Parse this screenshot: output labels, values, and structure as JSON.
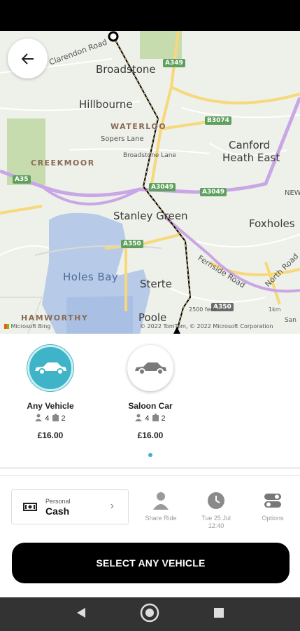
{
  "map": {
    "places": {
      "clarendon": "Clarendon Road",
      "broadstone": "Broadstone",
      "hillbourne": "Hillbourne",
      "waterloo": "WATERLOO",
      "sopers": "Sopers Lane",
      "broadstone_lane": "Broadstone Lane",
      "canford": "Canford",
      "canford2": "Heath East",
      "creekmoor": "CREEKMOOR",
      "stanley": "Stanley Green",
      "foxholes": "Foxholes",
      "holes_bay": "Holes Bay",
      "sterte": "Sterte",
      "poole": "Poole",
      "hamworthy": "HAMWORTHY",
      "fernside": "Fernside Road",
      "north_road": "North Road",
      "new": "NEW",
      "san": "San"
    },
    "roads": [
      "A349",
      "B3074",
      "A35",
      "A3049",
      "A3049",
      "A350",
      "A350"
    ],
    "scale": [
      "2500 feet",
      "1km"
    ],
    "attribution": "Microsoft Bing",
    "copyright": "© 2022 TomTom, © 2022 Microsoft Corporation"
  },
  "vehicles": [
    {
      "name": "Any Vehicle",
      "passengers": "4",
      "luggage": "2",
      "price": "£16.00"
    },
    {
      "name": "Saloon Car",
      "passengers": "4",
      "luggage": "2",
      "price": "£16.00"
    }
  ],
  "payment": {
    "label": "Personal",
    "value": "Cash"
  },
  "options": {
    "share": "Share Ride",
    "time_line1": "Tue 25 Jul",
    "time_line2": "12:40",
    "options": "Options"
  },
  "cta_label": "SELECT ANY VEHICLE",
  "colors": {
    "accent": "#3fb3c7",
    "route": "#000000",
    "motorway": "#c9a6e6",
    "major_road": "#f7d87a"
  }
}
